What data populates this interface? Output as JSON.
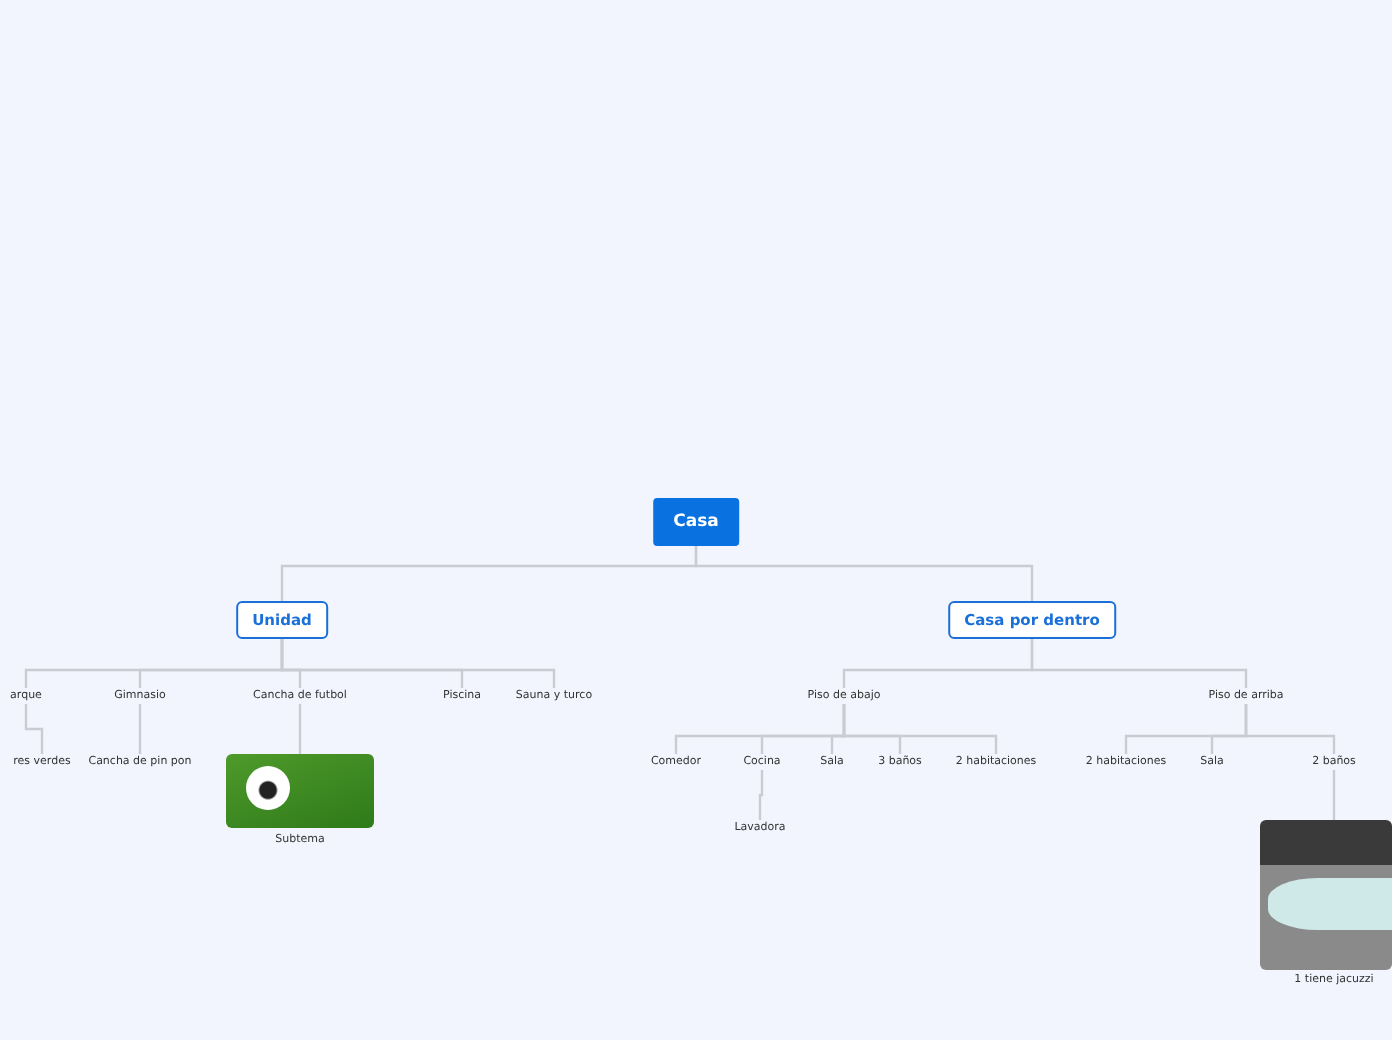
{
  "map": {
    "label": "Casa",
    "kind": "root",
    "children": [
      {
        "label": "Unidad",
        "kind": "main",
        "children": [
          {
            "label": "arque",
            "kind": "topic",
            "children": [
              {
                "label": "res verdes",
                "kind": "topic"
              }
            ]
          },
          {
            "label": "Gimnasio",
            "kind": "topic",
            "children": [
              {
                "label": "Cancha de pin pon",
                "kind": "topic"
              }
            ]
          },
          {
            "label": "Cancha de futbol",
            "kind": "topic",
            "children": [
              {
                "label": "Subtema",
                "kind": "pitch"
              }
            ]
          },
          {
            "label": "Piscina",
            "kind": "topic"
          },
          {
            "label": "Sauna y turco",
            "kind": "topic"
          }
        ]
      },
      {
        "label": "Casa por dentro",
        "kind": "main",
        "children": [
          {
            "label": "Piso de abajo",
            "kind": "topic",
            "children": [
              {
                "label": "Comedor",
                "kind": "topic"
              },
              {
                "label": "Cocina",
                "kind": "topic",
                "children": [
                  {
                    "label": "Lavadora",
                    "kind": "topic"
                  }
                ]
              },
              {
                "label": "Sala",
                "kind": "topic"
              },
              {
                "label": "3 baños",
                "kind": "topic"
              },
              {
                "label": "2 habitaciones",
                "kind": "topic"
              }
            ]
          },
          {
            "label": "Piso de arriba",
            "kind": "topic",
            "children": [
              {
                "label": "2 habitaciones",
                "kind": "topic"
              },
              {
                "label": "Sala",
                "kind": "topic"
              },
              {
                "label": "2 baños",
                "kind": "topic",
                "children": [
                  {
                    "label": "1 tiene jacuzzi",
                    "kind": "bathtub"
                  }
                ]
              }
            ]
          }
        ]
      }
    ]
  }
}
